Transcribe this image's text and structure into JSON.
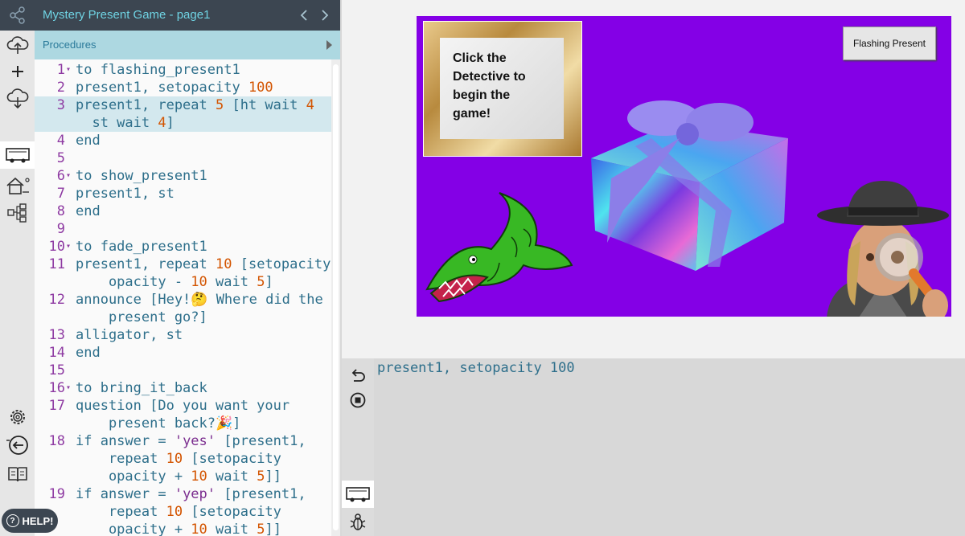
{
  "titlebar": {
    "title": "Mystery Present Game - page1"
  },
  "procedures": {
    "label": "Procedures"
  },
  "code_lines": [
    {
      "num": "1",
      "fold": true,
      "text": "to flashing_present1"
    },
    {
      "num": "2",
      "text": "present1, setopacity 100"
    },
    {
      "num": "3",
      "text": "present1, repeat 5 [ht wait 4"
    },
    {
      "num": "",
      "text": "  st wait 4]"
    },
    {
      "num": "4",
      "text": "end"
    },
    {
      "num": "5",
      "text": ""
    },
    {
      "num": "6",
      "fold": true,
      "text": "to show_present1"
    },
    {
      "num": "7",
      "text": "present1, st"
    },
    {
      "num": "8",
      "text": "end"
    },
    {
      "num": "9",
      "text": ""
    },
    {
      "num": "10",
      "fold": true,
      "text": "to fade_present1"
    },
    {
      "num": "11",
      "text": "present1, repeat 10 [setopacity"
    },
    {
      "num": "",
      "text": "    opacity - 10 wait 5]"
    },
    {
      "num": "12",
      "text": "announce [Hey!🤔 Where did the"
    },
    {
      "num": "",
      "text": "    present go?]"
    },
    {
      "num": "13",
      "text": "alligator, st"
    },
    {
      "num": "14",
      "text": "end"
    },
    {
      "num": "15",
      "text": ""
    },
    {
      "num": "16",
      "fold": true,
      "text": "to bring_it_back"
    },
    {
      "num": "17",
      "text": "question [Do you want your"
    },
    {
      "num": "",
      "text": "    present back?🎉]"
    },
    {
      "num": "18",
      "text": "if answer = 'yes' [present1,"
    },
    {
      "num": "",
      "text": "    repeat 10 [setopacity"
    },
    {
      "num": "",
      "text": "    opacity + 10 wait 5]]"
    },
    {
      "num": "19",
      "text": "if answer = 'yep' [present1,"
    },
    {
      "num": "",
      "text": "    repeat 10 [setopacity"
    },
    {
      "num": "",
      "text": "    opacity + 10 wait 5]]"
    }
  ],
  "stage": {
    "background": "#8400e6",
    "frame_text": "Click the Detective to begin the game!",
    "button_label": "Flashing Present"
  },
  "console": {
    "text": "present1, setopacity 100"
  },
  "help": {
    "label": "HELP!"
  },
  "icons": [
    "share-icon",
    "cloud-upload-icon",
    "plus-icon",
    "cloud-download-icon",
    "turtle-view-icon",
    "house-icon",
    "tree-icon",
    "gear-icon",
    "back-arrow-icon",
    "book-icon",
    "undo-icon",
    "stop-icon",
    "bug-icon"
  ]
}
